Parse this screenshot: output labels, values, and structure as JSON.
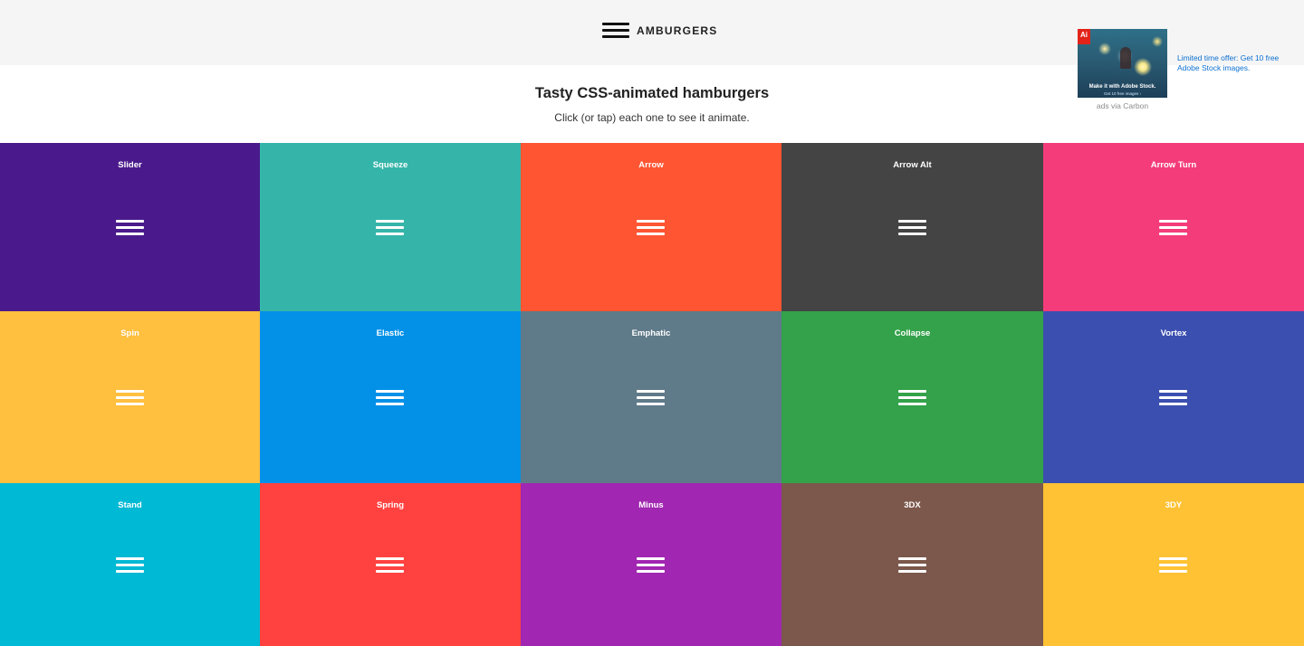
{
  "header": {
    "logo_text": "AMBURGERS",
    "logo_icon": "hamburger-icon",
    "background": "#f5f5f5"
  },
  "intro": {
    "title": "Tasty CSS-animated hamburgers",
    "subtitle": "Click (or tap) each one to see it animate."
  },
  "ad": {
    "image_caption": "Make it with Adobe Stock.",
    "image_subcaption": "Get 10 free images ›",
    "image_brand_mark": "Ai",
    "text": "Limited time offer: Get 10 free Adobe Stock images.",
    "via": "ads via Carbon",
    "link_color": "#0b6fd1"
  },
  "hamburgers": [
    {
      "label": "Slider",
      "color": "#4a1a8c"
    },
    {
      "label": "Squeeze",
      "color": "#35b5a9"
    },
    {
      "label": "Arrow",
      "color": "#ff5533"
    },
    {
      "label": "Arrow Alt",
      "color": "#444444"
    },
    {
      "label": "Arrow Turn",
      "color": "#f43c7a"
    },
    {
      "label": "Spin",
      "color": "#ffbf3f"
    },
    {
      "label": "Elastic",
      "color": "#0391e8"
    },
    {
      "label": "Emphatic",
      "color": "#5f7a89"
    },
    {
      "label": "Collapse",
      "color": "#33a24a"
    },
    {
      "label": "Vortex",
      "color": "#3b4fb0"
    },
    {
      "label": "Stand",
      "color": "#00b9d4"
    },
    {
      "label": "Spring",
      "color": "#ff4240"
    },
    {
      "label": "Minus",
      "color": "#a126b1"
    },
    {
      "label": "3DX",
      "color": "#7b584b"
    },
    {
      "label": "3DY",
      "color": "#ffc234"
    }
  ]
}
